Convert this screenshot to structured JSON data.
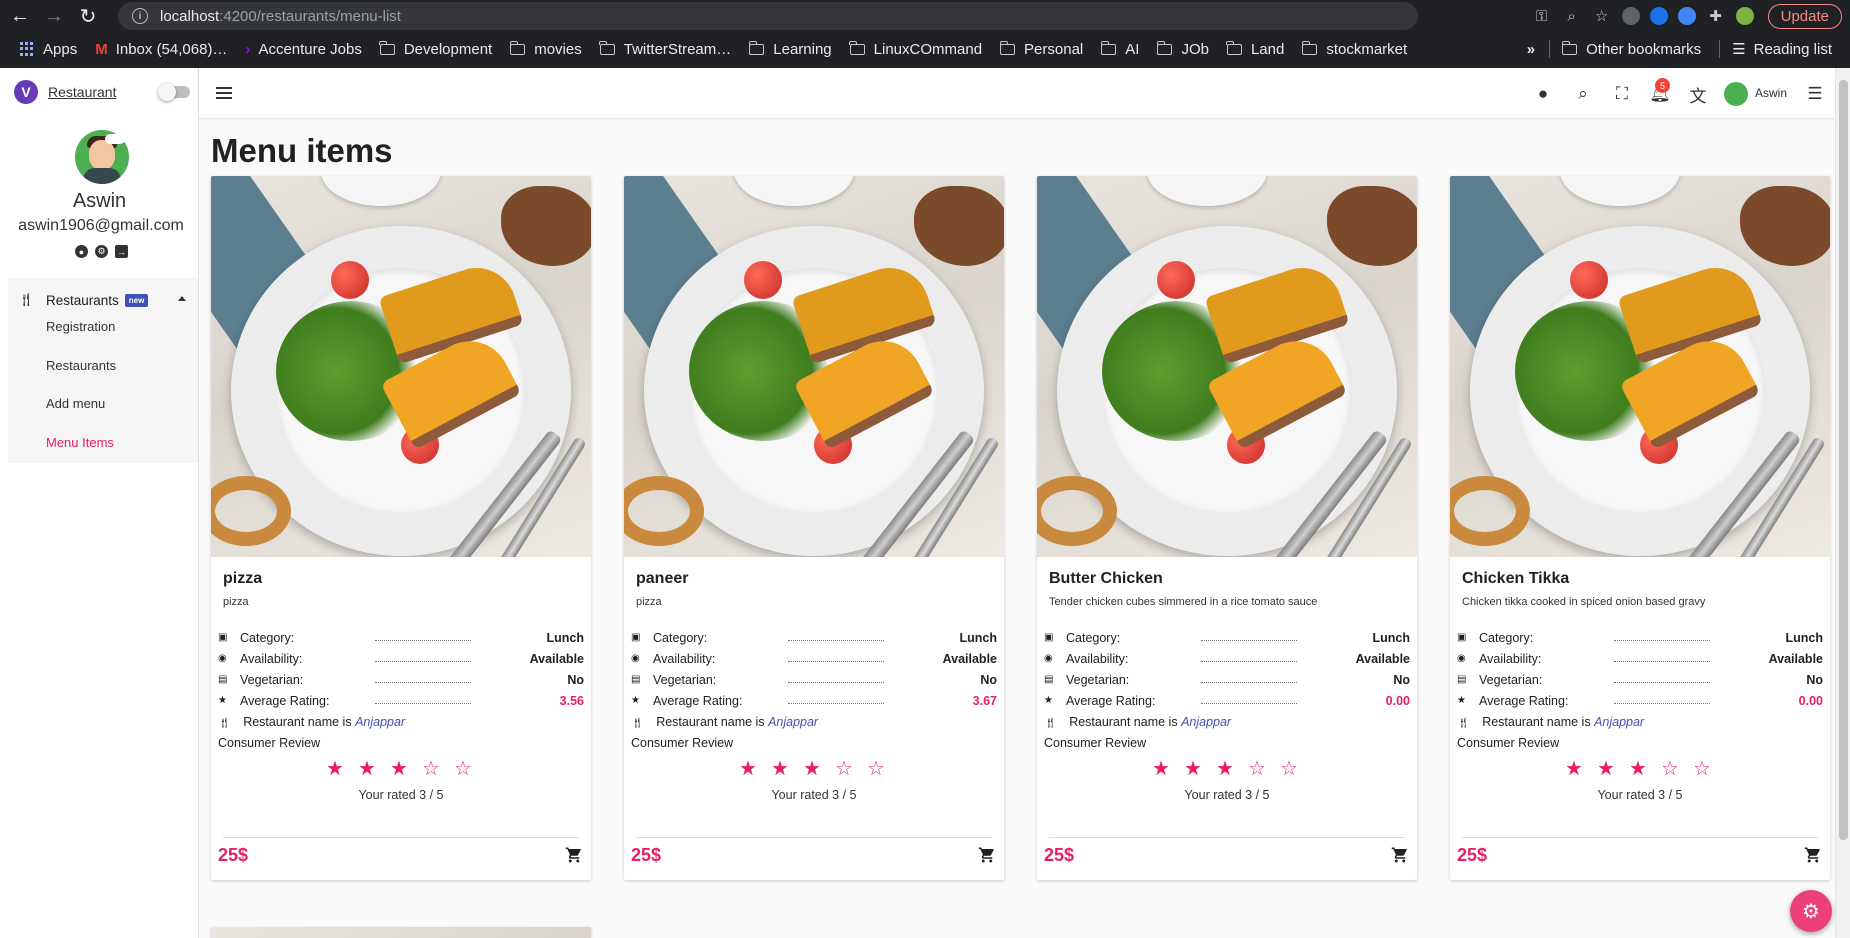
{
  "browser": {
    "url_host": "localhost",
    "url_path": ":4200/restaurants/menu-list",
    "update_label": "Update",
    "bookmarks": [
      "Apps",
      "Inbox (54,068)…",
      "Accenture Jobs",
      "Development",
      "movies",
      "TwitterStream…",
      "Learning",
      "LinuxCOmmand",
      "Personal",
      "AI",
      "JOb",
      "Land",
      "stockmarket"
    ],
    "other_bookmarks": "Other bookmarks",
    "reading_list": "Reading list"
  },
  "sidebar": {
    "brand": "Restaurant",
    "profile_name": "Aswin",
    "profile_email": "aswin1906@gmail.com",
    "group_label": "Restaurants",
    "group_badge": "new",
    "items": [
      {
        "label": "Registration"
      },
      {
        "label": "Restaurants"
      },
      {
        "label": "Add menu"
      },
      {
        "label": "Menu Items"
      }
    ]
  },
  "topbar": {
    "notification_count": "5",
    "user_name": "Aswin"
  },
  "page": {
    "title": "Menu items"
  },
  "spec_labels": {
    "category": "Category:",
    "availability": "Availability:",
    "vegetarian": "Vegetarian:",
    "rating": "Average Rating:",
    "restaurant_prefix": "Restaurant name is",
    "review": "Consumer Review"
  },
  "cards": [
    {
      "name": "pizza",
      "description": "pizza",
      "category": "Lunch",
      "availability": "Available",
      "vegetarian": "No",
      "rating": "3.56",
      "restaurant": "Anjappar",
      "user_rating": 3,
      "rated_text": "Your rated 3 / 5",
      "price": "25$"
    },
    {
      "name": "paneer",
      "description": "pizza",
      "category": "Lunch",
      "availability": "Available",
      "vegetarian": "No",
      "rating": "3.67",
      "restaurant": "Anjappar",
      "user_rating": 3,
      "rated_text": "Your rated 3 / 5",
      "price": "25$"
    },
    {
      "name": "Butter Chicken",
      "description": "Tender chicken cubes simmered in a rice tomato sauce",
      "category": "Lunch",
      "availability": "Available",
      "vegetarian": "No",
      "rating": "0.00",
      "restaurant": "Anjappar",
      "user_rating": 3,
      "rated_text": "Your rated 3 / 5",
      "price": "25$"
    },
    {
      "name": "Chicken Tikka",
      "description": "Chicken tikka cooked in spiced onion based gravy",
      "category": "Lunch",
      "availability": "Available",
      "vegetarian": "No",
      "rating": "0.00",
      "restaurant": "Anjappar",
      "user_rating": 3,
      "rated_text": "Your rated 3 / 5",
      "price": "25$"
    }
  ],
  "colors": {
    "accent": "#e91e63",
    "brand": "#673ab7",
    "link": "#3f51b5"
  }
}
